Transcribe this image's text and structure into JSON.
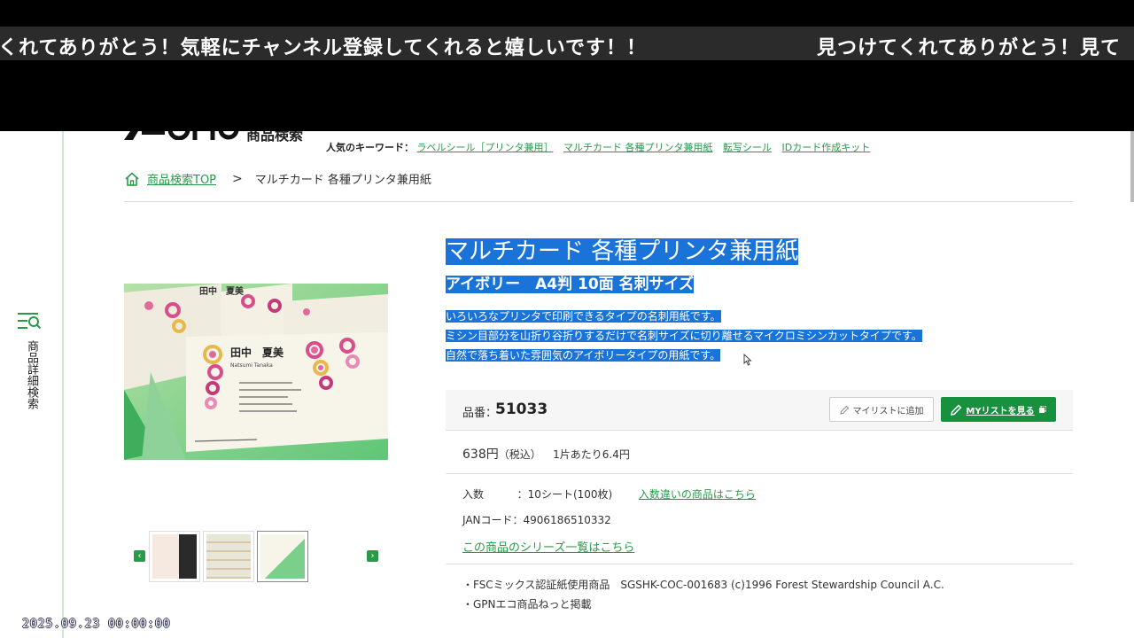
{
  "overlay": {
    "ticker_1": "くれてありがとう！気軽にチャンネル登録してくれると嬉しいです！！",
    "ticker_2": "見つけてくれてありがとう！見て"
  },
  "sidebar": {
    "label": "商品詳細検索",
    "icon": "search-menu-icon"
  },
  "header": {
    "logo_text": "商品検索",
    "keywords_label": "人気のキーワード：",
    "keywords": [
      "ラベルシール［プリンタ兼用］",
      "マルチカード 各種プリンタ兼用紙",
      "転写シール",
      "IDカード作成キット"
    ]
  },
  "breadcrumb": {
    "home": "商品検索TOP",
    "separator": ">",
    "current": "マルチカード 各種プリンタ兼用紙"
  },
  "product": {
    "title": "マルチカード 各種プリンタ兼用紙",
    "subtitle": "アイボリー　A4判 10面 名刺サイズ",
    "description": [
      "いろいろなプリンタで印刷できるタイプの名刺用紙です。",
      "ミシン目部分を山折り谷折りするだけで名刺サイズに切り離せるマイクロミシンカットタイプです。",
      "自然で落ち着いた雰囲気のアイボリータイプの用紙です。"
    ],
    "number_label": "品番：",
    "number": "51033",
    "add_mylist": "マイリストに追加",
    "view_mylist": "MYリストを見る",
    "price": "638円",
    "price_tax": "（税込）",
    "price_per": "1片あたり6.4円",
    "qty_label": "入数",
    "qty_value": "：10シート(100枚)",
    "qty_link": "入数違いの商品はこちら",
    "jan": "JANコード：4906186510332",
    "series_link": "この商品のシリーズ一覧はこちら",
    "notes": [
      "・FSCミックス認証紙使用商品　SGSHK-COC-001683 (c)1996 Forest Stewardship Council A.C.",
      "・GPNエコ商品ねっと掲載"
    ],
    "card_name": "田中　夏美",
    "card_romaji": "Natsumi Tanaka"
  },
  "colors": {
    "accent_green": "#17913d",
    "link_green": "#2a9a4a",
    "selection_blue": "#1a73d9"
  },
  "timestamp": "2025.09.23 00:00:00"
}
